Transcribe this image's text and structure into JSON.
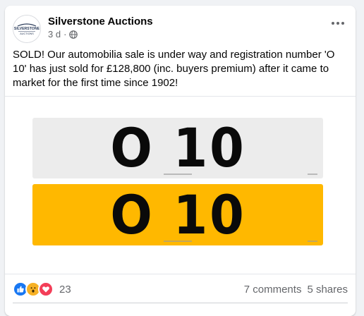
{
  "post": {
    "page_name": "Silverstone Auctions",
    "timestamp": "3 d",
    "separator": "·",
    "text": "SOLD! Our automobilia sale is under way and registration number 'O 10' has just sold for £128,800 (inc. buyers premium) after it came to market for the first time since 1902!",
    "avatar_logo_text": "SILVERSTONE AUCTIONS",
    "plates": {
      "front_text": "O 10",
      "rear_text": "O 10",
      "front_color": "#ececec",
      "rear_color": "#ffb800"
    },
    "reactions": {
      "icons": [
        "like-icon",
        "wow-icon",
        "love-icon"
      ],
      "count": "23"
    },
    "comments": "7 comments",
    "shares": "5 shares"
  }
}
